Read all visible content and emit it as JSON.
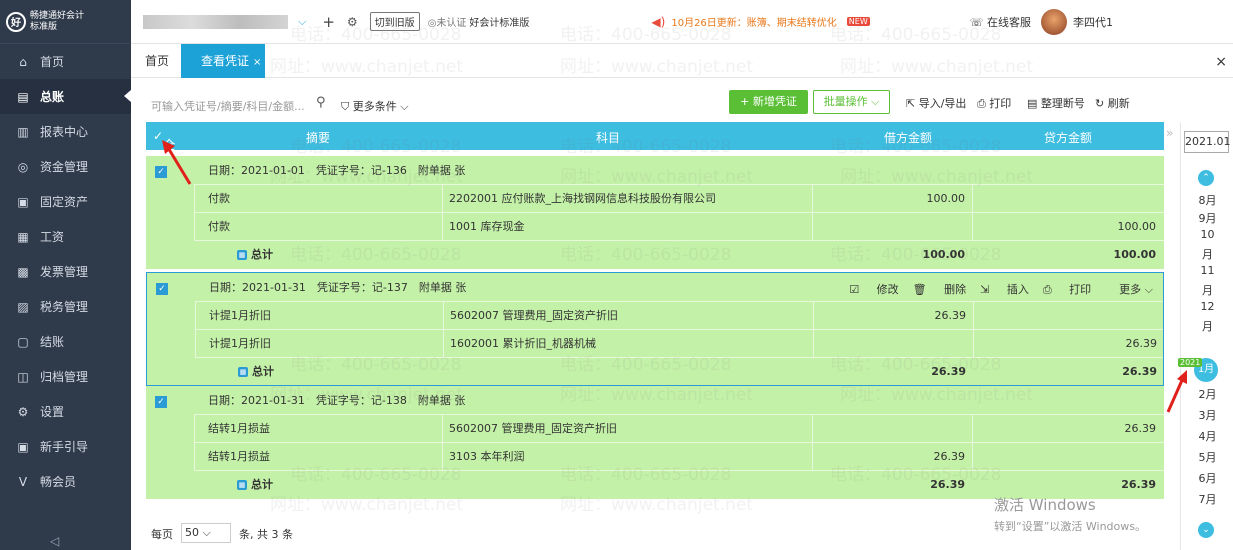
{
  "brand": {
    "logo": "好",
    "name": "畅捷通好会计",
    "edition": "标准版"
  },
  "sidebar": {
    "items": [
      {
        "icon": "⌂",
        "label": "首页"
      },
      {
        "icon": "▤",
        "label": "总账"
      },
      {
        "icon": "▥",
        "label": "报表中心"
      },
      {
        "icon": "◎",
        "label": "资金管理"
      },
      {
        "icon": "▣",
        "label": "固定资产"
      },
      {
        "icon": "▦",
        "label": "工资"
      },
      {
        "icon": "▩",
        "label": "发票管理"
      },
      {
        "icon": "▨",
        "label": "税务管理"
      },
      {
        "icon": "▢",
        "label": "结账"
      },
      {
        "icon": "◫",
        "label": "归档管理"
      },
      {
        "icon": "⚙",
        "label": "设置"
      },
      {
        "icon": "▣",
        "label": "新手引导"
      },
      {
        "icon": "V",
        "label": "畅会员"
      }
    ]
  },
  "topbar": {
    "switch_label": "切到旧版",
    "cert_label": "◎未认证",
    "std_label": "好会计标准版",
    "notice": "10月26日更新：账簿、期末结转优化",
    "new_badge": "NEW",
    "service_label": "在线客服",
    "user_name": "李四代1"
  },
  "tabs": {
    "home": "首页",
    "voucher": "查看凭证",
    "close": "×"
  },
  "toolbar": {
    "search_placeholder": "可输入凭证号/摘要/科目/金额...",
    "more_conditions": "更多条件",
    "new_voucher": "+ 新增凭证",
    "batch": "批量操作",
    "import_export": "导入/导出",
    "print": "打印",
    "renumber": "整理断号",
    "refresh": "刷新"
  },
  "grid": {
    "headers": {
      "select_all": "全选",
      "summary": "摘要",
      "subject": "科目",
      "debit": "借方金额",
      "credit": "贷方金额"
    },
    "total_label": "总计",
    "actions": {
      "edit": "修改",
      "delete": "删除",
      "insert": "插入",
      "print": "打印",
      "more": "更多"
    },
    "vouchers": [
      {
        "header": "日期：2021-01-01　凭证字号：记-136　附单据 张",
        "lines": [
          {
            "summary": "付款",
            "subject": "2202001 应付账款_上海找钢网信息科技股份有限公司",
            "debit": "100.00",
            "credit": ""
          },
          {
            "summary": "付款",
            "subject": "1001 库存现金",
            "debit": "",
            "credit": "100.00"
          }
        ],
        "total_debit": "100.00",
        "total_credit": "100.00"
      },
      {
        "header": "日期：2021-01-31　凭证字号：记-137　附单据 张",
        "lines": [
          {
            "summary": "计提1月折旧",
            "subject": "5602007 管理费用_固定资产折旧",
            "debit": "26.39",
            "credit": ""
          },
          {
            "summary": "计提1月折旧",
            "subject": "1602001 累计折旧_机器机械",
            "debit": "",
            "credit": "26.39"
          }
        ],
        "total_debit": "26.39",
        "total_credit": "26.39"
      },
      {
        "header": "日期：2021-01-31　凭证字号：记-138　附单据 张",
        "lines": [
          {
            "summary": "结转1月损益",
            "subject": "5602007 管理费用_固定资产折旧",
            "debit": "",
            "credit": "26.39"
          },
          {
            "summary": "结转1月损益",
            "subject": "3103 本年利润",
            "debit": "26.39",
            "credit": ""
          }
        ],
        "total_debit": "26.39",
        "total_credit": "26.39"
      }
    ]
  },
  "footer": {
    "per_page_label": "每页",
    "per_page_value": "50",
    "count_text": "条, 共 3 条"
  },
  "month_panel": {
    "year": "2021.01",
    "year_tag": "2021",
    "months_before": [
      "8月",
      "9月",
      "10",
      "月",
      "11",
      "月",
      "12",
      "月"
    ],
    "current": "1月",
    "months_after": [
      "2月",
      "3月",
      "4月",
      "5月",
      "6月",
      "7月"
    ]
  },
  "windows_mark": {
    "title": "激活 Windows",
    "subtitle": "转到“设置”以激活 Windows。"
  },
  "watermark": {
    "phone": "电话：400-665-0028",
    "site": "网址：www.chanjet.net"
  },
  "colors": {
    "sidebar": "#2f3a4a",
    "accent": "#1da2d8",
    "header": "#3dbde0",
    "row": "#c4f1a8",
    "green": "#5bbf36",
    "notice": "#e8781a"
  }
}
